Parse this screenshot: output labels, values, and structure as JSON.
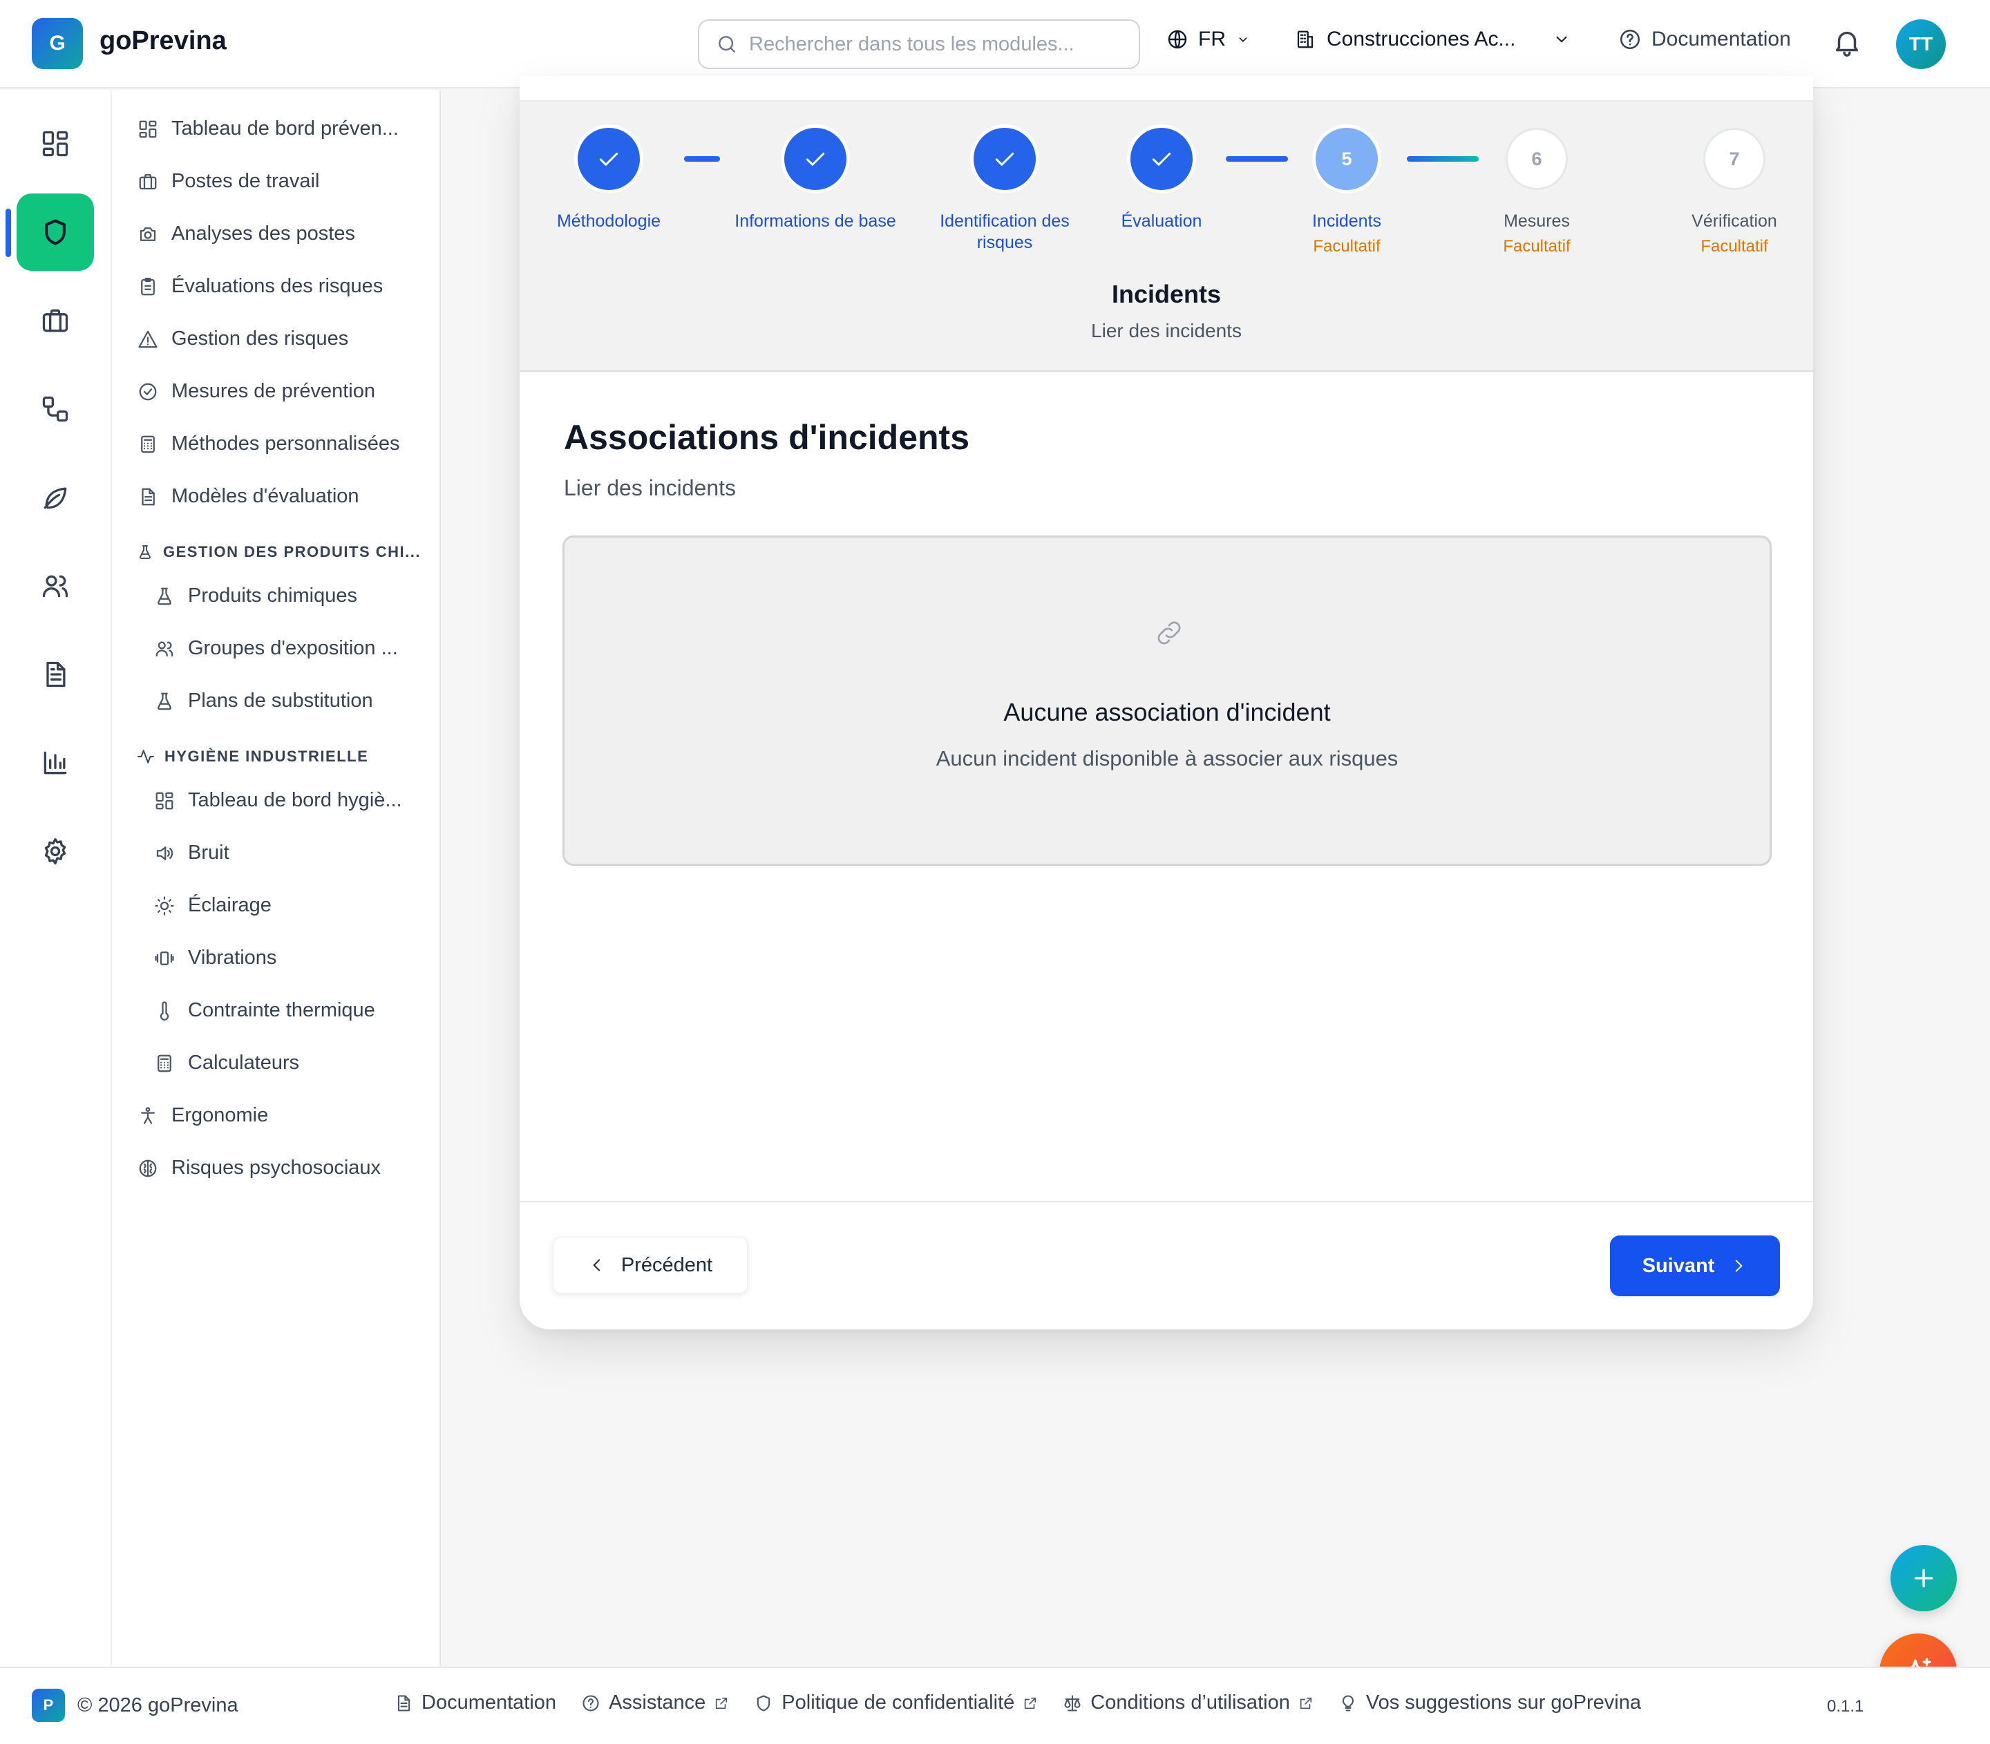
{
  "app": {
    "logo_letter": "G",
    "name": "goPrevina"
  },
  "header": {
    "search_placeholder": "Rechercher dans tous les modules...",
    "language": "FR",
    "company": "Construcciones Ac...",
    "documentation": "Documentation",
    "avatar_initials": "TT"
  },
  "rail": {
    "items": [
      {
        "icon": "dashboard-icon"
      },
      {
        "icon": "shield-icon",
        "active": true
      },
      {
        "icon": "briefcase-icon"
      },
      {
        "icon": "workflow-icon"
      },
      {
        "icon": "leaf-icon"
      },
      {
        "icon": "users-icon"
      },
      {
        "icon": "document-icon"
      },
      {
        "icon": "bar-chart-icon"
      },
      {
        "icon": "settings-icon"
      }
    ]
  },
  "sidebar": {
    "items": [
      {
        "label": "Tableau de bord préven...",
        "icon": "dashboard-icon"
      },
      {
        "label": "Postes de travail",
        "icon": "briefcase-icon"
      },
      {
        "label": "Analyses des postes",
        "icon": "camera-icon"
      },
      {
        "label": "Évaluations des risques",
        "icon": "clipboard-icon"
      },
      {
        "label": "Gestion des risques",
        "icon": "warning-icon"
      },
      {
        "label": "Mesures de prévention",
        "icon": "check-circle-icon"
      },
      {
        "label": "Méthodes personnalisées",
        "icon": "calculator-icon"
      },
      {
        "label": "Modèles d'évaluation",
        "icon": "file-text-icon"
      }
    ],
    "section_chemicals": {
      "title": "GESTION DES PRODUITS CHI...",
      "items": [
        {
          "label": "Produits chimiques",
          "icon": "flask-icon"
        },
        {
          "label": "Groupes d'exposition ...",
          "icon": "users-icon"
        },
        {
          "label": "Plans de substitution",
          "icon": "flask-icon"
        }
      ]
    },
    "section_hygiene": {
      "title": "HYGIÈNE INDUSTRIELLE",
      "items": [
        {
          "label": "Tableau de bord hygiè...",
          "icon": "dashboard-icon"
        },
        {
          "label": "Bruit",
          "icon": "speaker-icon"
        },
        {
          "label": "Éclairage",
          "icon": "sun-icon"
        },
        {
          "label": "Vibrations",
          "icon": "vibrate-icon"
        },
        {
          "label": "Contrainte thermique",
          "icon": "thermometer-icon"
        },
        {
          "label": "Calculateurs",
          "icon": "calculator-icon"
        }
      ]
    },
    "bottom_items": [
      {
        "label": "Ergonomie",
        "icon": "person-icon"
      },
      {
        "label": "Risques psychosociaux",
        "icon": "brain-icon"
      }
    ]
  },
  "stepper": {
    "steps": [
      {
        "number": "1",
        "label": "Méthodologie",
        "status": "done",
        "optional": ""
      },
      {
        "number": "2",
        "label": "Informations de base",
        "status": "done",
        "optional": ""
      },
      {
        "number": "3",
        "label": "Identification des risques",
        "status": "done",
        "optional": ""
      },
      {
        "number": "4",
        "label": "Évaluation",
        "status": "done",
        "optional": ""
      },
      {
        "number": "5",
        "label": "Incidents",
        "status": "current",
        "optional": "Facultatif"
      },
      {
        "number": "6",
        "label": "Mesures",
        "status": "todo",
        "optional": "Facultatif"
      },
      {
        "number": "7",
        "label": "Vérification",
        "status": "todo",
        "optional": "Facultatif"
      }
    ],
    "current_title": "Incidents",
    "current_subtitle": "Lier des incidents"
  },
  "main": {
    "title": "Associations d'incidents",
    "subtitle": "Lier des incidents",
    "empty_title": "Aucune association d'incident",
    "empty_description": "Aucun incident disponible à associer aux risques",
    "prev_label": "Précédent",
    "next_label": "Suivant"
  },
  "footer": {
    "badge_letter": "P",
    "copyright": "© 2026 goPrevina",
    "links": [
      {
        "label": "Documentation",
        "icon": "file-text-icon",
        "external": false
      },
      {
        "label": "Assistance",
        "icon": "help-circle-icon",
        "external": true
      },
      {
        "label": "Politique de confidentialité",
        "icon": "shield-icon",
        "external": true
      },
      {
        "label": "Conditions d’utilisation",
        "icon": "scale-icon",
        "external": true
      },
      {
        "label": "Vos suggestions sur goPrevina",
        "icon": "lightbulb-icon",
        "external": false
      }
    ],
    "version": "0.1.1"
  },
  "colors": {
    "primary": "#1552ef",
    "active_rail": "#10c47e",
    "optional": "#d97706"
  }
}
